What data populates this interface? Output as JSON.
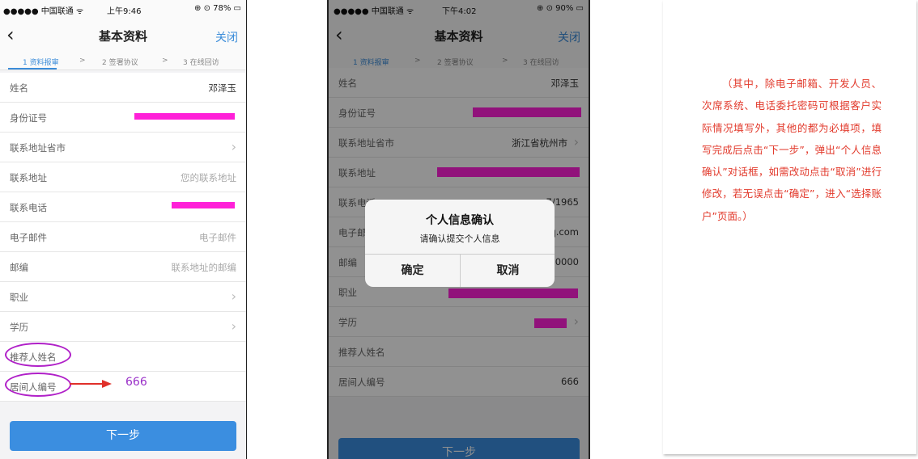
{
  "left_phone": {
    "status": {
      "carrier": "●●●●● 中国联通 ᯤ",
      "time": "上午9:46",
      "battery": "⊕ ⊙ 78% ▭"
    },
    "nav": {
      "back": "‹",
      "title": "基本资料",
      "close": "关闭"
    },
    "steps": [
      "1 资料报审",
      "2 签署协议",
      "3 在线回访"
    ],
    "step_sep": ">",
    "rows": [
      {
        "label": "姓名",
        "value": "邓泽玉"
      },
      {
        "label": "身份证号",
        "value": ""
      },
      {
        "label": "联系地址省市",
        "value": ""
      },
      {
        "label": "联系地址",
        "value": "您的联系地址"
      },
      {
        "label": "联系电话",
        "value": ""
      },
      {
        "label": "电子邮件",
        "value": "电子邮件"
      },
      {
        "label": "邮编",
        "value": "联系地址的邮编"
      },
      {
        "label": "职业",
        "value": ""
      },
      {
        "label": "学历",
        "value": ""
      },
      {
        "label": "推荐人姓名",
        "value": ""
      },
      {
        "label": "居间人编号",
        "value": ""
      }
    ],
    "annotation_value": "666",
    "next_button": "下一步"
  },
  "right_phone": {
    "status": {
      "carrier": "●●●●● 中国联通 ᯤ",
      "time": "下午4:02",
      "battery": "⊕ ⊙ 90% ▭"
    },
    "nav": {
      "back": "‹",
      "title": "基本资料",
      "close": "关闭"
    },
    "steps": [
      "1 资料报审",
      "2 签署协议",
      "3 在线回访"
    ],
    "step_sep": ">",
    "rows": [
      {
        "label": "姓名",
        "value": "邓泽玉"
      },
      {
        "label": "身份证号",
        "value": ""
      },
      {
        "label": "联系地址省市",
        "value": "浙江省杭州市"
      },
      {
        "label": "联系地址",
        "value": ""
      },
      {
        "label": "联系电话",
        "value": "7/1965"
      },
      {
        "label": "电子邮件",
        "value": "q.com"
      },
      {
        "label": "邮编",
        "value": "0000"
      },
      {
        "label": "职业",
        "value": ""
      },
      {
        "label": "学历",
        "value": ""
      },
      {
        "label": "推荐人姓名",
        "value": ""
      },
      {
        "label": "居间人编号",
        "value": "666"
      }
    ],
    "dialog": {
      "title": "个人信息确认",
      "message": "请确认提交个人信息",
      "confirm": "确定",
      "cancel": "取消"
    },
    "next_button": "下一步"
  },
  "note": {
    "text": "（其中，除电子邮箱、开发人员、次席系统、电话委托密码可根据客户实际情况填写外，其他的都为必填项，填写完成后点击“下一步”，弹出“个人信息确认”对话框，如需改动点击“取消”进行修改，若无误点击“确定”，进入“选择账户”页面。）"
  },
  "colors": {
    "accent": "#3b8ee0",
    "redaction": "#ff20d8",
    "highlight": "#b020c8",
    "note_text": "#e23a2c"
  }
}
